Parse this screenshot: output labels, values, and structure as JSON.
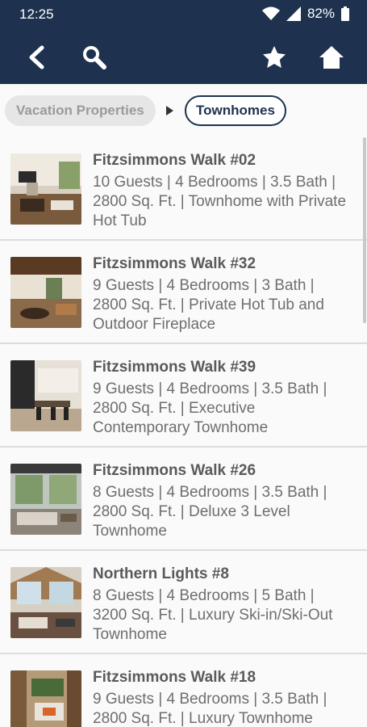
{
  "status": {
    "time": "12:25",
    "battery": "82%"
  },
  "appbar": {
    "back_icon": "back-icon",
    "search_icon": "search-icon",
    "favorite_icon": "star-icon",
    "home_icon": "home-icon"
  },
  "breadcrumb": {
    "parent": "Vacation Properties",
    "current": "Townhomes"
  },
  "colors": {
    "header": "#1e3250",
    "background": "#f4f4f4"
  },
  "listings": [
    {
      "title": "Fitzsimmons Walk #02",
      "details": "10 Guests | 4 Bedrooms | 3.5 Bath | 2800 Sq. Ft. | Townhome with Private Hot Tub"
    },
    {
      "title": "Fitzsimmons Walk #32",
      "details": "9 Guests | 4 Bedrooms | 3 Bath | 2800 Sq. Ft. | Private Hot Tub and Outdoor Fireplace"
    },
    {
      "title": "Fitzsimmons Walk #39",
      "details": "9 Guests | 4 Bedrooms | 3.5 Bath | 2800 Sq. Ft. | Executive Contemporary Townhome"
    },
    {
      "title": "Fitzsimmons Walk #26",
      "details": "8 Guests | 4 Bedrooms | 3.5 Bath | 2800 Sq. Ft. | Deluxe 3 Level Townhome"
    },
    {
      "title": "Northern Lights #8",
      "details": "8 Guests | 4 Bedrooms | 5 Bath | 3200 Sq. Ft. | Luxury Ski-in/Ski-Out Townhome"
    },
    {
      "title": "Fitzsimmons Walk #18",
      "details": "9 Guests | 4 Bedrooms | 3.5 Bath | 2800 Sq. Ft. | Luxury Townhome"
    }
  ]
}
